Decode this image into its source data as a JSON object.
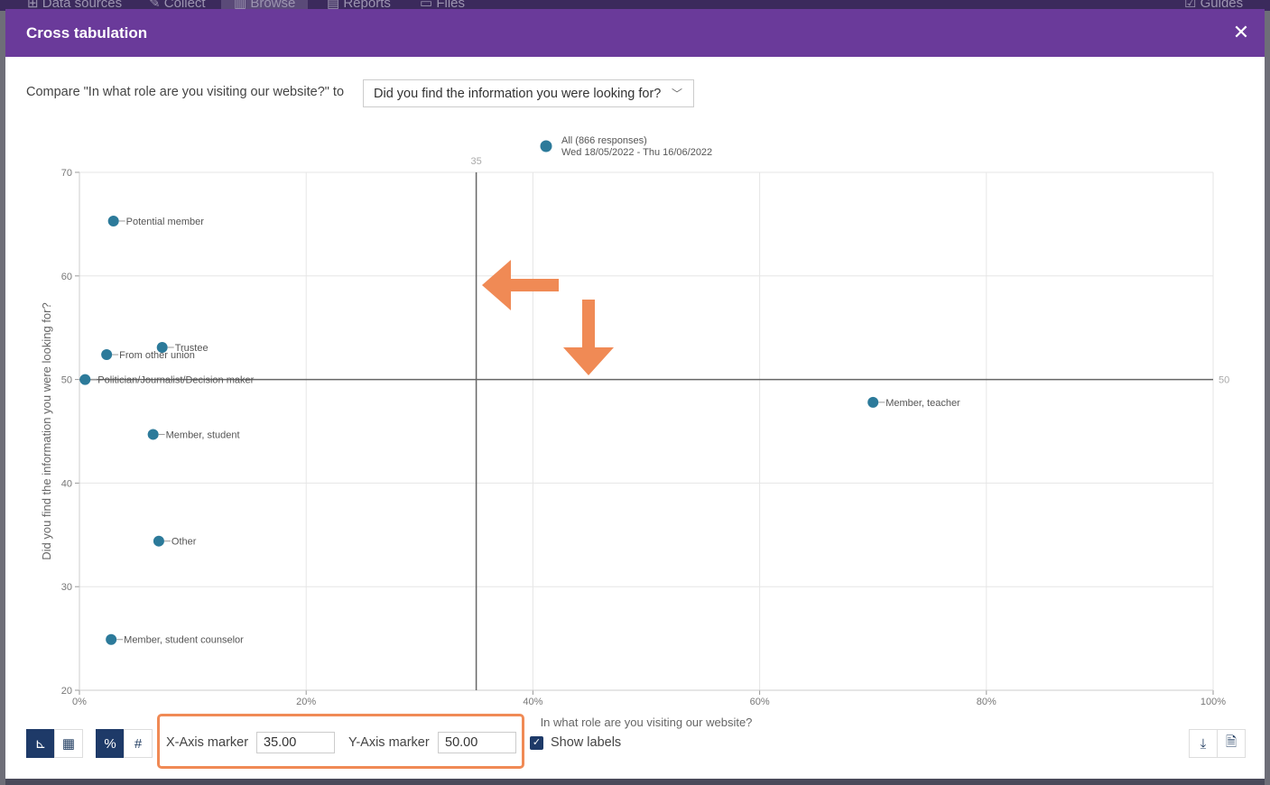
{
  "background_nav": {
    "items": [
      "Data sources",
      "Collect",
      "Browse",
      "Reports",
      "Files"
    ],
    "right_item": "Guides"
  },
  "dialog": {
    "title": "Cross tabulation",
    "compare_label": "Compare \"In what role are you visiting our website?\" to",
    "compare_select_value": "Did you find the information you were looking for?",
    "x_axis_marker_label": "X-Axis marker",
    "x_axis_marker_value": "35.00",
    "y_axis_marker_label": "Y-Axis marker",
    "y_axis_marker_value": "50.00",
    "show_labels_label": "Show labels",
    "show_labels_checked": true
  },
  "colors": {
    "header": "#6a3a9a",
    "point": "#2c7a9a",
    "annotation": "#f08a55",
    "active_button": "#1e3a68"
  },
  "icons": [
    "close-icon",
    "chevron-down-icon",
    "scatter-chart-icon",
    "table-icon",
    "percent-icon",
    "hash-icon",
    "checkbox-checked-icon",
    "download-icon",
    "export-file-icon",
    "arrow-left-annotation",
    "arrow-down-annotation"
  ],
  "chart_data": {
    "type": "scatter",
    "xlabel": "In what role are you visiting our website?",
    "ylabel": "Did you find the information you were looking for?",
    "xlim": [
      0,
      100
    ],
    "ylim": [
      20,
      70
    ],
    "x_ticks": [
      "0%",
      "20%",
      "40%",
      "60%",
      "80%",
      "100%"
    ],
    "y_ticks": [
      "20",
      "30",
      "40",
      "50",
      "60",
      "70"
    ],
    "grid": true,
    "legend": {
      "label": "All (866 responses)",
      "sublabel": "Wed 18/05/2022 - Thu 16/06/2022",
      "placement": "top-center"
    },
    "x_marker": {
      "value": 35,
      "label": "35"
    },
    "y_marker": {
      "value": 50,
      "label": "50"
    },
    "points": [
      {
        "label": "Potential member",
        "x": 3,
        "y": 65.3
      },
      {
        "label": "Trustee",
        "x": 7.3,
        "y": 53.1
      },
      {
        "label": "From other union",
        "x": 2.4,
        "y": 52.4
      },
      {
        "label": "Politician/Journalist/Decision maker",
        "x": 0.5,
        "y": 50
      },
      {
        "label": "Member, teacher",
        "x": 70,
        "y": 47.8
      },
      {
        "label": "Member, student",
        "x": 6.5,
        "y": 44.7
      },
      {
        "label": "Other",
        "x": 7,
        "y": 34.4
      },
      {
        "label": "Member, student counselor",
        "x": 2.8,
        "y": 24.9
      }
    ]
  }
}
